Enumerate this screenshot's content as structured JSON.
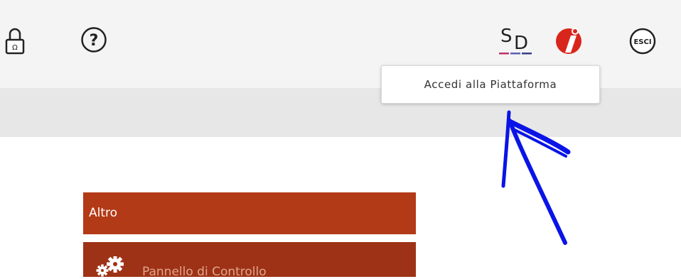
{
  "toolbar": {
    "icons": [
      "lock-icon",
      "help-icon",
      "sd-logo-icon",
      "info-icon",
      "exit-icon"
    ],
    "sd_logo_text": "SD",
    "exit_icon_text": "ESCI",
    "help_icon_text": "?"
  },
  "tooltip": {
    "text": "Accedi alla Piattaforma"
  },
  "menu": {
    "header": "Altro",
    "items": [
      {
        "label": "Pannello di Controllo",
        "icon": "gears-icon"
      }
    ]
  },
  "colors": {
    "menu_header": "#b33a16",
    "menu_item": "#9e3216",
    "annotation_arrow": "#0a14e6",
    "info_icon": "#d9261c"
  }
}
